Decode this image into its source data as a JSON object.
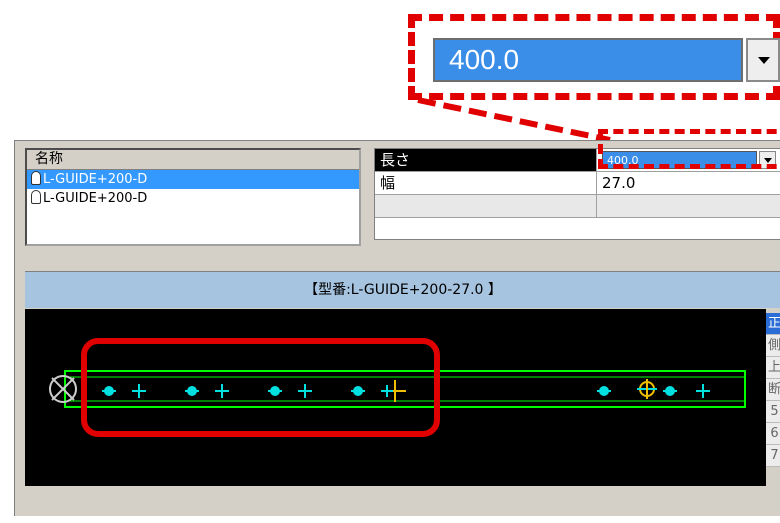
{
  "zoom": {
    "length_value": "400.0"
  },
  "name_list": {
    "header": "名称",
    "items": [
      {
        "label": "L-GUIDE+200-D",
        "selected": true
      },
      {
        "label": "L-GUIDE+200-D",
        "selected": false
      }
    ]
  },
  "properties": {
    "length_label": "長さ",
    "length_value": "400.0",
    "width_label": "幅",
    "width_value": "27.0"
  },
  "model": {
    "title": "【型番:L-GUIDE+200-27.0 】",
    "view_tabs": [
      "正",
      "側",
      "上",
      "断",
      "5",
      "6",
      "7"
    ],
    "active_tab": 0
  },
  "colors": {
    "highlight_red": "#e00000",
    "selection_blue": "#3399ff",
    "model_green": "#00ff00",
    "marker_cyan": "#00e0e0",
    "marker_yellow": "#f0c000"
  }
}
